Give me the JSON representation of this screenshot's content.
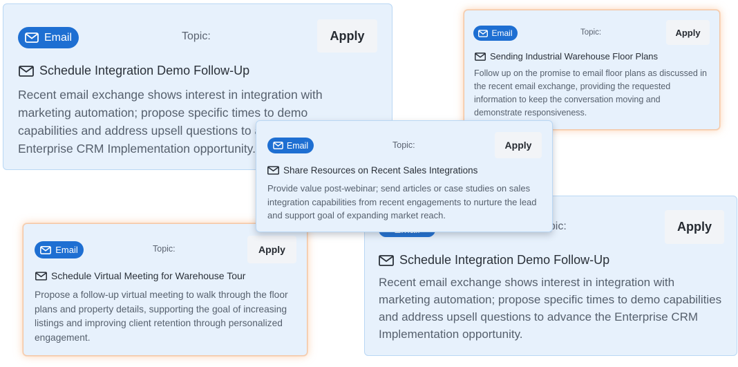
{
  "cards": [
    {
      "channel_label": "Email",
      "topic_label": "Topic:",
      "apply_label": "Apply",
      "title": "Schedule Integration Demo Follow-Up",
      "description": "Recent email exchange shows interest in integration with marketing automation; propose specific times to demo capabilities and address upsell questions to advance the Enterprise CRM Implementation opportunity.",
      "icon": "envelope-icon"
    },
    {
      "channel_label": "Email",
      "topic_label": "Topic:",
      "apply_label": "Apply",
      "title": "Sending Industrial Warehouse Floor Plans",
      "description": "Follow up on the promise to email floor plans as discussed in the recent email exchange, providing the requested information to keep the conversation moving and demonstrate responsiveness.",
      "icon": "envelope-icon"
    },
    {
      "channel_label": "Email",
      "topic_label": "Topic:",
      "apply_label": "Apply",
      "title": "Share Resources on Recent Sales Integrations",
      "description": "Provide value post-webinar; send articles or case studies on sales integration capabilities from recent engagements to nurture the lead and support goal of expanding market reach.",
      "icon": "envelope-icon"
    },
    {
      "channel_label": "Email",
      "topic_label": "Topic:",
      "apply_label": "Apply",
      "title": "Schedule Integration Demo Follow-Up",
      "description": "Recent email exchange shows interest in integration with marketing automation; propose specific times to demo capabilities and address upsell questions to advance the Enterprise CRM Implementation opportunity.",
      "icon": "envelope-icon"
    },
    {
      "channel_label": "Email",
      "topic_label": "Topic:",
      "apply_label": "Apply",
      "title": "Schedule Virtual Meeting for Warehouse Tour",
      "description": "Propose a follow-up virtual meeting to walk through the floor plans and property details, supporting the goal of increasing listings and improving client retention through personalized engagement.",
      "icon": "envelope-icon"
    }
  ],
  "colors": {
    "pill_background": "#1e6fd2",
    "card_background": "#e7f1fc",
    "card_border": "#b9d7f4",
    "highlight_glow": "#f7ab70",
    "apply_background": "#f2f4f7"
  }
}
